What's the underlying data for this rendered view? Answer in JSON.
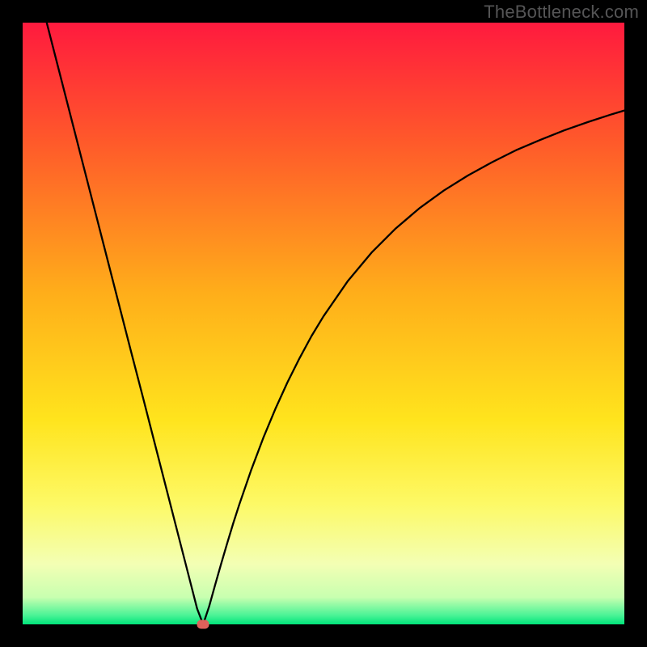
{
  "watermark": "TheBottleneck.com",
  "colors": {
    "background": "#000000",
    "gradient_stops": [
      {
        "offset": 0.0,
        "color": "#ff1a3e"
      },
      {
        "offset": 0.2,
        "color": "#ff5a2a"
      },
      {
        "offset": 0.45,
        "color": "#ffae1a"
      },
      {
        "offset": 0.66,
        "color": "#ffe41d"
      },
      {
        "offset": 0.8,
        "color": "#fdf966"
      },
      {
        "offset": 0.9,
        "color": "#f3ffb4"
      },
      {
        "offset": 0.955,
        "color": "#c8ffb0"
      },
      {
        "offset": 0.985,
        "color": "#4af396"
      },
      {
        "offset": 1.0,
        "color": "#00e47a"
      }
    ],
    "curve": "#000000",
    "marker": "#e0615b"
  },
  "chart_data": {
    "type": "line",
    "title": "",
    "xlabel": "",
    "ylabel": "",
    "xlim": [
      0,
      100
    ],
    "ylim": [
      0,
      100
    ],
    "legend": false,
    "grid": false,
    "annotations": [],
    "series": [
      {
        "name": "bottleneck-curve",
        "x": [
          4,
          6,
          8,
          10,
          12,
          14,
          16,
          18,
          20,
          22,
          24,
          26,
          27,
          28,
          29,
          30,
          31,
          32,
          33,
          34,
          35,
          36,
          38,
          40,
          42,
          44,
          46,
          48,
          50,
          54,
          58,
          62,
          66,
          70,
          74,
          78,
          82,
          86,
          90,
          94,
          98,
          100
        ],
        "y": [
          100,
          92.2,
          84.4,
          76.6,
          68.8,
          61.0,
          53.2,
          45.4,
          37.7,
          29.9,
          22.1,
          14.3,
          10.4,
          6.5,
          2.6,
          0.0,
          3.0,
          6.6,
          10.1,
          13.5,
          16.8,
          19.9,
          25.7,
          31.0,
          35.8,
          40.2,
          44.2,
          47.9,
          51.2,
          57.0,
          61.8,
          65.8,
          69.2,
          72.1,
          74.6,
          76.8,
          78.8,
          80.5,
          82.1,
          83.5,
          84.8,
          85.4
        ]
      }
    ],
    "marker": {
      "x": 30,
      "y": 0
    }
  }
}
